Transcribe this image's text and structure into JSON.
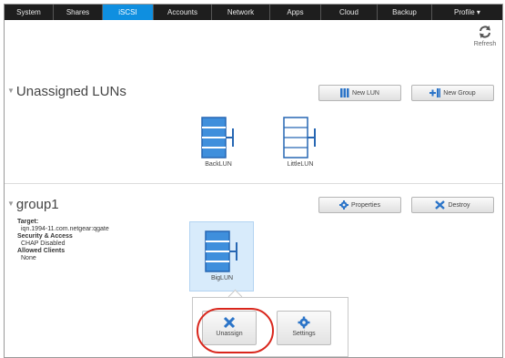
{
  "nav": {
    "tabs": [
      {
        "label": "System"
      },
      {
        "label": "Shares"
      },
      {
        "label": "iSCSI"
      },
      {
        "label": "Accounts"
      },
      {
        "label": "Network"
      },
      {
        "label": "Apps"
      },
      {
        "label": "Cloud"
      },
      {
        "label": "Backup"
      },
      {
        "label": "Profile ▾"
      }
    ],
    "active_tab": "iSCSI"
  },
  "toolbar": {
    "refresh_label": "Refresh",
    "refresh_icon": "refresh-icon"
  },
  "unassigned": {
    "title": "Unassigned LUNs",
    "new_lun_label": "New LUN",
    "new_group_label": "New Group",
    "luns": [
      {
        "label": "BackLUN",
        "icon": "lun-thick-icon"
      },
      {
        "label": "LittleLUN",
        "icon": "lun-thin-icon"
      }
    ]
  },
  "group": {
    "title": "group1",
    "properties_label": "Properties",
    "destroy_label": "Destroy",
    "target_heading": "Target:",
    "target_value": "iqn.1994-11.com.netgear:qgate",
    "security_heading": "Security & Access",
    "security_value": "CHAP Disabled",
    "clients_heading": "Allowed Clients",
    "clients_value": "None",
    "lun": {
      "label": "BigLUN",
      "icon": "lun-thick-icon"
    }
  },
  "popup": {
    "unassign_label": "Unassign",
    "settings_label": "Settings"
  },
  "colors": {
    "nav_bg": "#1e1e1e",
    "active_tab": "#0f8fe0",
    "lun_blue": "#3f8fdc",
    "highlight": "#d9261c"
  }
}
